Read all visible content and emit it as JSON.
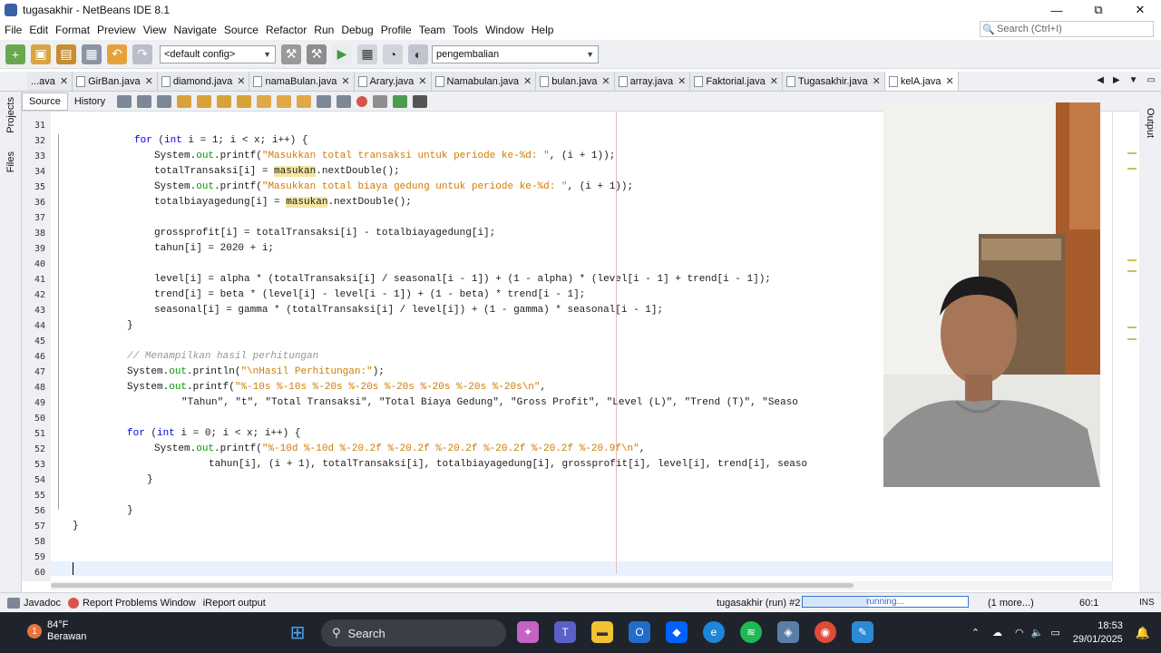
{
  "window": {
    "title": "tugasakhir - NetBeans IDE 8.1",
    "minimize": "—",
    "maximize": "⧉",
    "close": "✕"
  },
  "menu": [
    "File",
    "Edit",
    "Format",
    "Preview",
    "View",
    "Navigate",
    "Source",
    "Refactor",
    "Run",
    "Debug",
    "Profile",
    "Team",
    "Tools",
    "Window",
    "Help"
  ],
  "search": {
    "placeholder": "Search (Ctrl+I)"
  },
  "toolbar": {
    "config": "<default config>",
    "project_combo": "pengembalian"
  },
  "tabs": [
    {
      "label": "...ava",
      "active": false
    },
    {
      "label": "GirBan.java",
      "active": false
    },
    {
      "label": "diamond.java",
      "active": false
    },
    {
      "label": "namaBulan.java",
      "active": false
    },
    {
      "label": "Arary.java",
      "active": false
    },
    {
      "label": "Namabulan.java",
      "active": false
    },
    {
      "label": "bulan.java",
      "active": false
    },
    {
      "label": "array.java",
      "active": false
    },
    {
      "label": "Faktorial.java",
      "active": false
    },
    {
      "label": "Tugasakhir.java",
      "active": false
    },
    {
      "label": "kelA.java",
      "active": true
    }
  ],
  "side_panels": {
    "projects": "Projects",
    "files": "Files",
    "output": "Output"
  },
  "editor_tabs": {
    "source": "Source",
    "history": "History"
  },
  "line_numbers": [
    "31",
    "32",
    "33",
    "34",
    "35",
    "36",
    "37",
    "38",
    "39",
    "40",
    "41",
    "42",
    "43",
    "44",
    "45",
    "46",
    "47",
    "48",
    "49",
    "50",
    "51",
    "52",
    "53",
    "54",
    "55",
    "56",
    "57",
    "58",
    "59",
    "60"
  ],
  "code": {
    "l32": {
      "a": "for",
      "b": " (",
      "c": "int",
      "d": " i = 1; i < x; i++) {"
    },
    "l33": {
      "a": "System.",
      "b": "out",
      "c": ".printf(",
      "d": "\"Masukkan total transaksi untuk periode ke-%d: \"",
      "e": ", (i + 1));"
    },
    "l34": {
      "a": "totalTransaksi[i] = ",
      "b": "masukan",
      "c": ".nextDouble();"
    },
    "l35": {
      "a": "System.",
      "b": "out",
      "c": ".printf(",
      "d": "\"Masukkan total biaya gedung untuk periode ke-%d: \"",
      "e": ", (i + 1));"
    },
    "l36": {
      "a": "totalbiayagedung[i] = ",
      "b": "masukan",
      "c": ".nextDouble();"
    },
    "l38": "grossprofit[i] = totalTransaksi[i] - totalbiayagedung[i];",
    "l39": "tahun[i] = 2020 + i;",
    "l41": "level[i] = alpha * (totalTransaksi[i] / seasonal[i - 1]) + (1 - alpha) * (level[i - 1] + trend[i - 1]);",
    "l42": "trend[i] = beta * (level[i] - level[i - 1]) + (1 - beta) * trend[i - 1];",
    "l43": "seasonal[i] = gamma * (totalTransaksi[i] / level[i]) + (1 - gamma) * seasonal[i - 1];",
    "l44": "}",
    "l46": "// Menampilkan hasil perhitungan",
    "l47": {
      "a": "System.",
      "b": "out",
      "c": ".println(",
      "d": "\"\\nHasil Perhitungan:\"",
      "e": ");"
    },
    "l48": {
      "a": "System.",
      "b": "out",
      "c": ".printf(",
      "d": "\"%-10s %-10s %-20s %-20s %-20s %-20s %-20s %-20s\\n\"",
      "e": ","
    },
    "l49": "\"Tahun\", \"t\", \"Total Transaksi\", \"Total Biaya Gedung\", \"Gross Profit\", \"Level (L)\", \"Trend (T)\", \"Seaso",
    "l51": {
      "a": "for",
      "b": " (",
      "c": "int",
      "d": " i = 0; i < x; i++) {"
    },
    "l52": {
      "a": "System.",
      "b": "out",
      "c": ".printf(",
      "d": "\"%-10d %-10d %-20.2f %-20.2f %-20.2f %-20.2f %-20.2f %-20.9f\\n\"",
      "e": ","
    },
    "l53": "tahun[i], (i + 1), totalTransaksi[i], totalbiayagedung[i], grossprofit[i], level[i], trend[i], seaso",
    "l54": "}",
    "l56": "}",
    "l57": "}"
  },
  "status": {
    "javadoc": "Javadoc",
    "problems": "Report Problems Window",
    "ireport": "iReport output",
    "run_label": "tugasakhir (run) #2",
    "progress_text": "running...",
    "more": "(1 more...)",
    "caret_pos": "60:1",
    "mode": "INS"
  },
  "taskbar": {
    "badge": "1",
    "temp": "84°F",
    "weather": "Berawan",
    "search": "Search",
    "time": "18:53",
    "date": "29/01/2025"
  },
  "colors": {
    "keyword": "#0000e6",
    "string": "#ce7b00",
    "field": "#009900",
    "comment": "#969696",
    "highlight": "#f5e7a2"
  }
}
